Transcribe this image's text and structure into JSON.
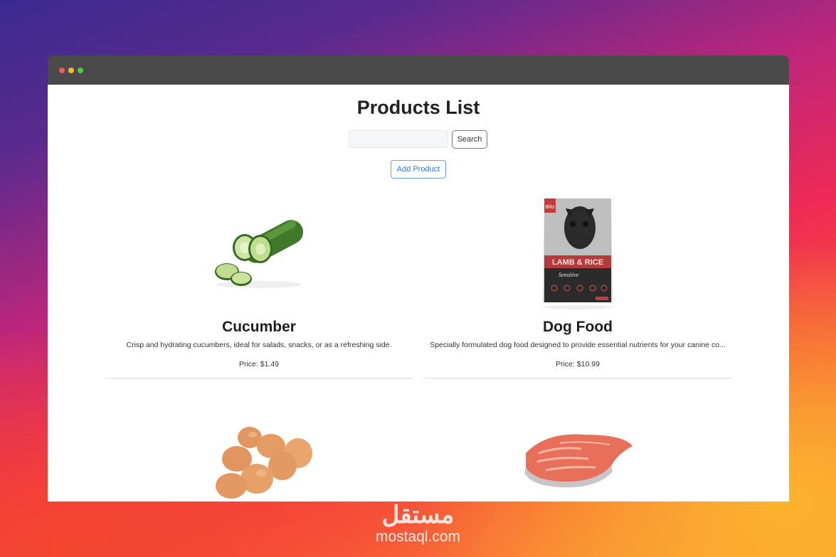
{
  "page": {
    "title": "Products List",
    "search_placeholder": "",
    "search_button": "Search",
    "add_button": "Add Product"
  },
  "products": [
    {
      "name": "Cucumber",
      "description": "Crisp and hydrating cucumbers, ideal for salads, snacks, or as a refreshing side.",
      "price": "Price: $1.49",
      "image": "cucumber-image"
    },
    {
      "name": "Dog Food",
      "description": "Specially formulated dog food designed to provide essential nutrients for your canine co...",
      "price": "Price: $10.99",
      "image": "dog-food-bag-image"
    },
    {
      "name": "",
      "description": "",
      "price": "",
      "image": "eggs-image"
    },
    {
      "name": "",
      "description": "",
      "price": "",
      "image": "salmon-steak-image"
    }
  ],
  "dog_food_bag": {
    "brand": "Blitz",
    "headline": "LAMB & RICE",
    "variant": "Sensitive"
  },
  "watermark": {
    "arabic": "مستقل",
    "latin": "mostaql.com"
  },
  "colors": {
    "accent_blue": "#2f78dd",
    "titlebar": "#4a4a4a",
    "dot_red": "#ee5c55",
    "dot_yellow": "#f2bd31",
    "dot_green": "#4fc946"
  }
}
